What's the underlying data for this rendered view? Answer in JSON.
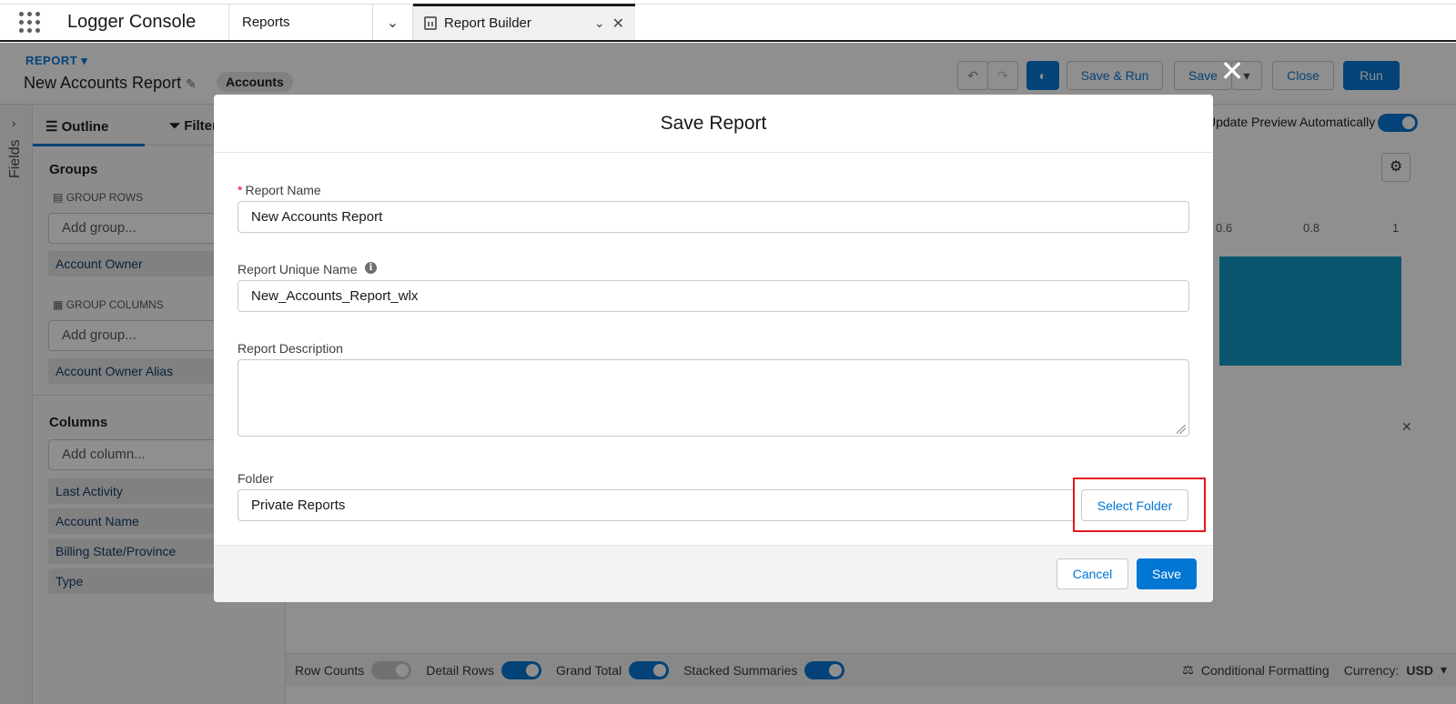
{
  "topnav": {
    "app_name": "Logger Console",
    "nav_item": "Reports",
    "active_tab": "Report Builder"
  },
  "background": {
    "kicker": "REPORT",
    "report_title": "New Accounts Report",
    "object_badge": "Accounts",
    "buttons": {
      "save_run": "Save & Run",
      "save": "Save",
      "close": "Close",
      "run": "Run"
    },
    "update_preview_label": "Update Preview Automatically",
    "outline_tab": "Outline",
    "filters_tab": "Filters",
    "fields_label": "Fields",
    "groups_title": "Groups",
    "group_rows_label": "GROUP ROWS",
    "group_columns_label": "GROUP COLUMNS",
    "add_group_placeholder": "Add group...",
    "group_row_field": "Account Owner",
    "group_column_field": "Account Owner Alias",
    "columns_title": "Columns",
    "add_column_placeholder": "Add column...",
    "columns": [
      "Last Activity",
      "Account Name",
      "Billing State/Province",
      "Type"
    ],
    "chart_ticks": [
      "0.6",
      "0.8",
      "1"
    ],
    "bottom": {
      "row_counts": "Row Counts",
      "detail_rows": "Detail Rows",
      "grand_total": "Grand Total",
      "stacked_summaries": "Stacked Summaries",
      "conditional_formatting": "Conditional Formatting",
      "currency_label": "Currency:",
      "currency_value": "USD"
    }
  },
  "modal": {
    "title": "Save Report",
    "report_name_label": "Report Name",
    "report_name_value": "New Accounts Report",
    "unique_name_label": "Report Unique Name",
    "unique_name_value": "New_Accounts_Report_wlx",
    "description_label": "Report Description",
    "description_value": "",
    "folder_label": "Folder",
    "folder_value": "Private Reports",
    "select_folder_label": "Select Folder",
    "cancel_label": "Cancel",
    "save_label": "Save"
  },
  "colors": {
    "brand": "#0176d3",
    "highlight": "#e8161c",
    "required": "#ea001e"
  }
}
